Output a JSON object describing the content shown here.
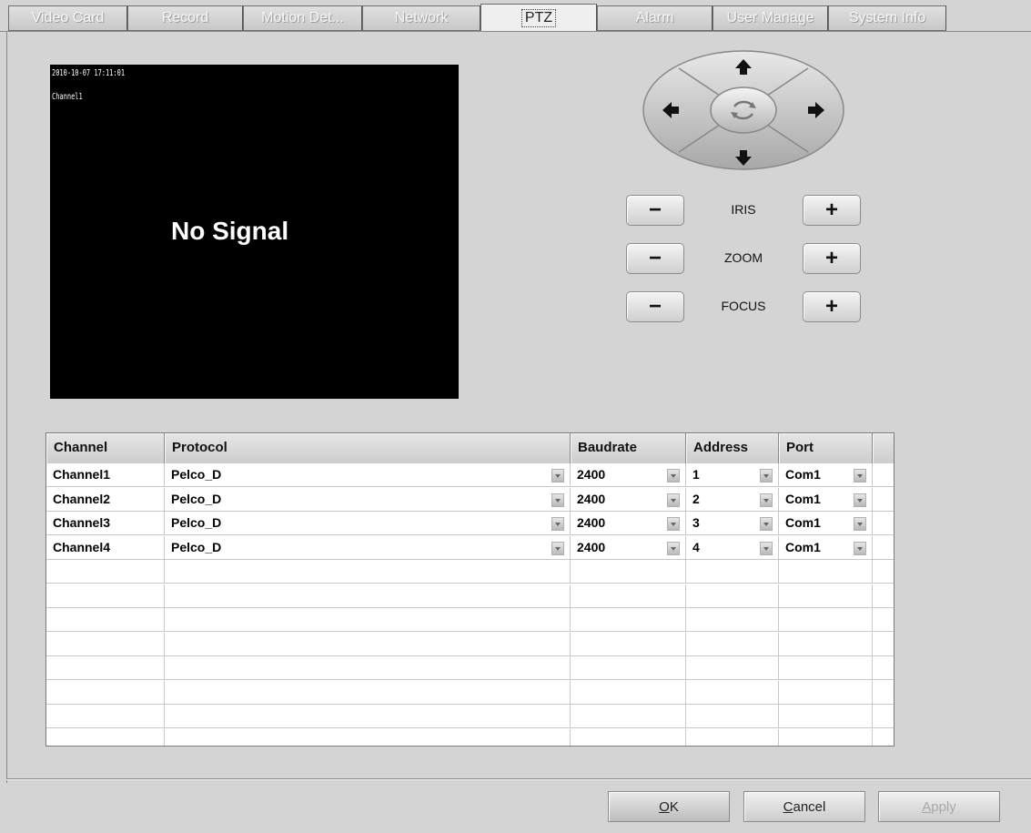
{
  "tabs": [
    {
      "label": "Video Card",
      "active": false
    },
    {
      "label": "Record",
      "active": false
    },
    {
      "label": "Motion Det...",
      "active": false
    },
    {
      "label": "Network",
      "active": false
    },
    {
      "label": "PTZ",
      "active": true
    },
    {
      "label": "Alarm",
      "active": false
    },
    {
      "label": "User Manage",
      "active": false
    },
    {
      "label": "System Info",
      "active": false
    }
  ],
  "preview": {
    "timestamp": "2010-10-07 17:11:01",
    "channel": "Channel1",
    "status": "No Signal"
  },
  "ptz": {
    "controls": [
      {
        "label": "IRIS",
        "minus": "−",
        "plus": "+"
      },
      {
        "label": "ZOOM",
        "minus": "−",
        "plus": "+"
      },
      {
        "label": "FOCUS",
        "minus": "−",
        "plus": "+"
      }
    ]
  },
  "table": {
    "headers": [
      "Channel",
      "Protocol",
      "Baudrate",
      "Address",
      "Port"
    ],
    "rows": [
      [
        "Channel1",
        "Pelco_D",
        "2400",
        "1",
        "Com1"
      ],
      [
        "Channel2",
        "Pelco_D",
        "2400",
        "2",
        "Com1"
      ],
      [
        "Channel3",
        "Pelco_D",
        "2400",
        "3",
        "Com1"
      ],
      [
        "Channel4",
        "Pelco_D",
        "2400",
        "4",
        "Com1"
      ]
    ]
  },
  "buttons": {
    "ok": {
      "mnemonic": "O",
      "rest": "K"
    },
    "cancel": {
      "mnemonic": "C",
      "rest": "ancel"
    },
    "apply": {
      "mnemonic": "A",
      "rest": "pply"
    }
  },
  "colors": {
    "background": "#d4d4d4",
    "preview": "#000000",
    "disabled_text": "#a8a8a8"
  }
}
